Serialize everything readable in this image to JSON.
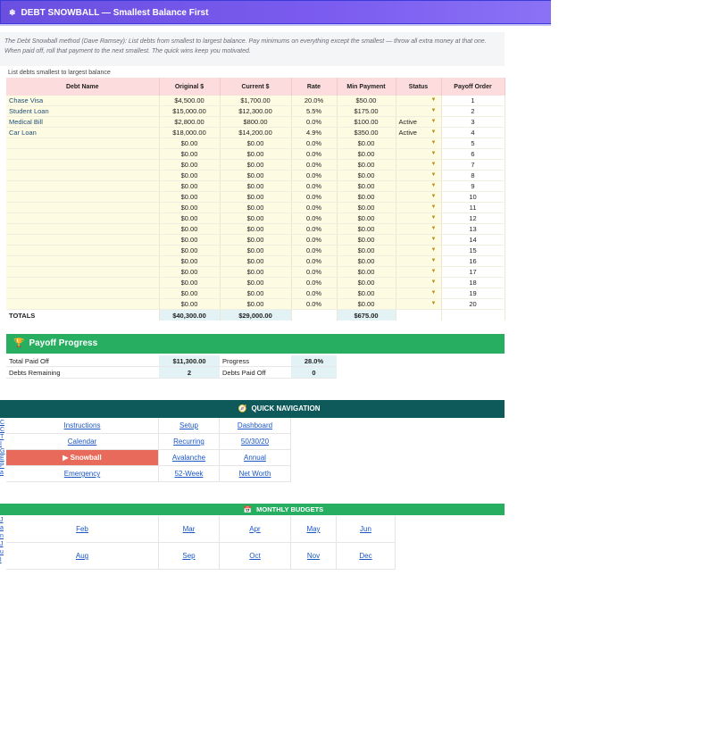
{
  "header": {
    "icon": "snowflake-icon",
    "title": "DEBT SNOWBALL — Smallest Balance First",
    "accent_color": "#6a4fe0"
  },
  "description": "The Debt Snowball method (Dave Ramsey): List debts from smallest to largest balance. Pay minimums on everything except the smallest — throw all extra money at that one. When paid off, roll that payment to the next smallest. The quick wins keep you motivated.",
  "list_hint": "List debts smallest to largest balance",
  "table": {
    "columns": [
      "Debt Name",
      "Original $",
      "Current $",
      "Rate",
      "Min Payment",
      "Status",
      "Payoff Order"
    ],
    "rows": [
      {
        "name": "Chase Visa",
        "original": "$4,500.00",
        "current": "$1,700.00",
        "rate": "20.0%",
        "min": "$50.00",
        "status": "",
        "order": "1"
      },
      {
        "name": "Student Loan",
        "original": "$15,000.00",
        "current": "$12,300.00",
        "rate": "5.5%",
        "min": "$175.00",
        "status": "",
        "order": "2"
      },
      {
        "name": "Medical Bill",
        "original": "$2,800.00",
        "current": "$800.00",
        "rate": "0.0%",
        "min": "$100.00",
        "status": "Active",
        "order": "3"
      },
      {
        "name": "Car Loan",
        "original": "$18,000.00",
        "current": "$14,200.00",
        "rate": "4.9%",
        "min": "$350.00",
        "status": "Active",
        "order": "4"
      },
      {
        "name": "",
        "original": "$0.00",
        "current": "$0.00",
        "rate": "0.0%",
        "min": "$0.00",
        "status": "",
        "order": "5"
      },
      {
        "name": "",
        "original": "$0.00",
        "current": "$0.00",
        "rate": "0.0%",
        "min": "$0.00",
        "status": "",
        "order": "6"
      },
      {
        "name": "",
        "original": "$0.00",
        "current": "$0.00",
        "rate": "0.0%",
        "min": "$0.00",
        "status": "",
        "order": "7"
      },
      {
        "name": "",
        "original": "$0.00",
        "current": "$0.00",
        "rate": "0.0%",
        "min": "$0.00",
        "status": "",
        "order": "8"
      },
      {
        "name": "",
        "original": "$0.00",
        "current": "$0.00",
        "rate": "0.0%",
        "min": "$0.00",
        "status": "",
        "order": "9"
      },
      {
        "name": "",
        "original": "$0.00",
        "current": "$0.00",
        "rate": "0.0%",
        "min": "$0.00",
        "status": "",
        "order": "10"
      },
      {
        "name": "",
        "original": "$0.00",
        "current": "$0.00",
        "rate": "0.0%",
        "min": "$0.00",
        "status": "",
        "order": "11"
      },
      {
        "name": "",
        "original": "$0.00",
        "current": "$0.00",
        "rate": "0.0%",
        "min": "$0.00",
        "status": "",
        "order": "12"
      },
      {
        "name": "",
        "original": "$0.00",
        "current": "$0.00",
        "rate": "0.0%",
        "min": "$0.00",
        "status": "",
        "order": "13"
      },
      {
        "name": "",
        "original": "$0.00",
        "current": "$0.00",
        "rate": "0.0%",
        "min": "$0.00",
        "status": "",
        "order": "14"
      },
      {
        "name": "",
        "original": "$0.00",
        "current": "$0.00",
        "rate": "0.0%",
        "min": "$0.00",
        "status": "",
        "order": "15"
      },
      {
        "name": "",
        "original": "$0.00",
        "current": "$0.00",
        "rate": "0.0%",
        "min": "$0.00",
        "status": "",
        "order": "16"
      },
      {
        "name": "",
        "original": "$0.00",
        "current": "$0.00",
        "rate": "0.0%",
        "min": "$0.00",
        "status": "",
        "order": "17"
      },
      {
        "name": "",
        "original": "$0.00",
        "current": "$0.00",
        "rate": "0.0%",
        "min": "$0.00",
        "status": "",
        "order": "18"
      },
      {
        "name": "",
        "original": "$0.00",
        "current": "$0.00",
        "rate": "0.0%",
        "min": "$0.00",
        "status": "",
        "order": "19"
      },
      {
        "name": "",
        "original": "$0.00",
        "current": "$0.00",
        "rate": "0.0%",
        "min": "$0.00",
        "status": "",
        "order": "20"
      }
    ],
    "totals": {
      "label": "TOTALS",
      "original": "$40,300.00",
      "current": "$29,000.00",
      "min": "$675.00"
    }
  },
  "payoff": {
    "icon": "trophy-icon",
    "title": "Payoff Progress",
    "total_paid_label": "Total Paid Off",
    "total_paid": "$11,300.00",
    "progress_label": "Progress",
    "progress": "28.0%",
    "remaining_label": "Debts Remaining",
    "remaining": "2",
    "paid_count_label": "Debts Paid Off",
    "paid_count": "0"
  },
  "quick_nav": {
    "icon": "compass-icon",
    "title": "QUICK NAVIGATION",
    "rows": [
      [
        "Instructions",
        "Setup",
        "Dashboard"
      ],
      [
        "Calendar",
        "Recurring",
        "50/30/20"
      ],
      [
        "▶ Snowball",
        "Avalanche",
        "Annual"
      ],
      [
        "Emergency",
        "52-Week",
        "Net Worth"
      ]
    ],
    "left_fragments": [
      "C",
      "C",
      "T",
      "I",
      "G",
      "E",
      "P",
      "a"
    ]
  },
  "monthly": {
    "icon": "calendar-icon",
    "title": "MONTHLY BUDGETS",
    "row1": [
      "Feb",
      "Mar",
      "Apr",
      "May",
      "Jun"
    ],
    "row2": [
      "Aug",
      "Sep",
      "Oct",
      "Nov",
      "Dec"
    ],
    "left_fragments": [
      "J",
      "a",
      "n",
      "J",
      "u",
      "l"
    ]
  },
  "colors": {
    "header_pink": "#fcdcdc",
    "input_yellow": "#fdfbe2",
    "green": "#27ae60",
    "teal": "#0e5a5a",
    "active_red": "#e86a5a"
  }
}
